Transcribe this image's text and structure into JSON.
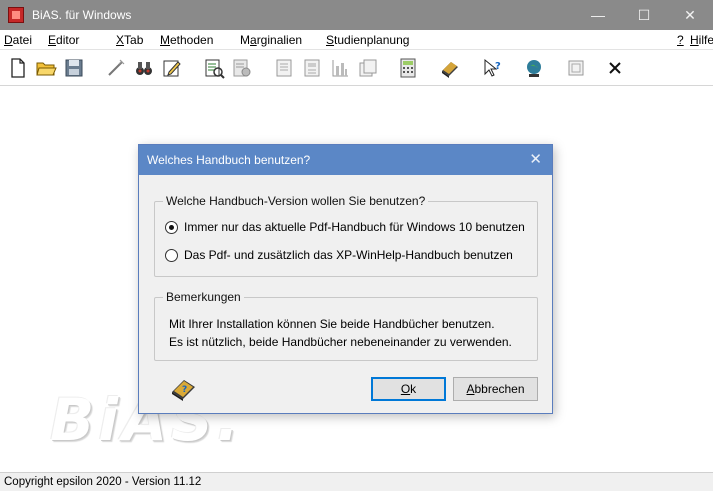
{
  "window": {
    "title": "BiAS. für Windows",
    "minimize": "—",
    "maximize": "☐",
    "close": "✕"
  },
  "menu": [
    {
      "label": "Datei",
      "mnemonic": "D",
      "rest": "atei"
    },
    {
      "label": "Editor",
      "mnemonic": "E",
      "rest": "ditor"
    },
    {
      "label": "XTab",
      "mnemonic": "X",
      "rest": "Tab"
    },
    {
      "label": "Methoden",
      "mnemonic": "M",
      "rest": "ethoden"
    },
    {
      "label": "Marginalien",
      "pre": "M",
      "mnemonic": "a",
      "rest": "rginalien"
    },
    {
      "label": "Studienplanung",
      "mnemonic": "S",
      "rest": "tudienplanung"
    },
    {
      "label": "?",
      "mnemonic": "?",
      "rest": ""
    },
    {
      "label": "Hilfe",
      "mnemonic": "H",
      "rest": "ilfe"
    }
  ],
  "toolbar": [
    "new-file-icon",
    "open-folder-icon",
    "save-disk-icon",
    "wizard-icon",
    "binoculars-icon",
    "edit-icon",
    "report-icon",
    "report-disabled-icon",
    "table-icon",
    "table-2-icon",
    "chart-icon",
    "copy-icon",
    "calculator-icon",
    "book-icon",
    "help-pointer-icon",
    "globe-icon",
    "window-icon",
    "close-icon"
  ],
  "dialog": {
    "title": "Welches Handbuch benutzen?",
    "close": "✕",
    "version_group": {
      "legend": "Welche Handbuch-Version wollen Sie benutzen?",
      "options": [
        {
          "label": "Immer nur das aktuelle Pdf-Handbuch für Windows 10 benutzen",
          "selected": true
        },
        {
          "label": "Das Pdf- und zusätzlich das XP-WinHelp-Handbuch benutzen",
          "selected": false
        }
      ]
    },
    "remarks_group": {
      "legend": "Bemerkungen",
      "lines": [
        "Mit Ihrer Installation können Sie beide Handbücher benutzen.",
        "Es ist nützlich, beide Handbücher nebeneinander zu verwenden."
      ]
    },
    "ok": {
      "mnemonic": "O",
      "rest": "k"
    },
    "cancel": {
      "mnemonic": "A",
      "rest": "bbrechen"
    }
  },
  "logo": "BiAS.",
  "status": "Copyright epsilon 2020 - Version 11.12",
  "colors": {
    "dialog_title": "#5b87c6",
    "titlebar": "#8a8a8a",
    "default_button_border": "#0078d7"
  }
}
